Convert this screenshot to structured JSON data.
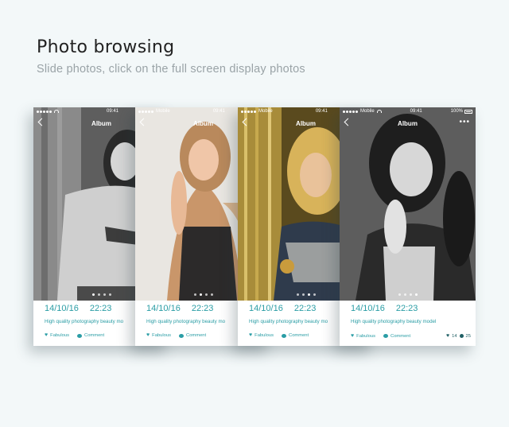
{
  "header": {
    "title": "Photo browsing",
    "subtitle": "Slide photos, click on the full screen display photos"
  },
  "cards": [
    {
      "status": {
        "carrier": "",
        "time": "09:41",
        "battery": ""
      },
      "nav_title": "Album",
      "date": "14/10/16",
      "time": "22:23",
      "caption": "High quality photography beauty mo",
      "like_label": "Fabulous",
      "comment_label": "Comment"
    },
    {
      "status": {
        "carrier": "Mobile",
        "time": "09:41",
        "battery": ""
      },
      "nav_title": "Album",
      "date": "14/10/16",
      "time": "22:23",
      "caption": "High quality photography beauty mo",
      "like_label": "Fabulous",
      "comment_label": "Comment"
    },
    {
      "status": {
        "carrier": "Mobile",
        "time": "09:41",
        "battery": ""
      },
      "nav_title": "Album",
      "date": "14/10/16",
      "time": "22:23",
      "caption": "High quality photography beauty mo",
      "like_label": "Fabulous",
      "comment_label": "Comment"
    },
    {
      "status": {
        "carrier": "Mobile",
        "time": "09:41",
        "battery": "100%"
      },
      "nav_title": "Album",
      "date": "14/10/16",
      "time": "22:23",
      "caption": "High quality photography beauty model",
      "like_label": "Fabulous",
      "comment_label": "Comment",
      "likes": "14",
      "comments": "25"
    }
  ],
  "colors": {
    "accent": "#2a9da5",
    "background": "#f3f8f9"
  }
}
